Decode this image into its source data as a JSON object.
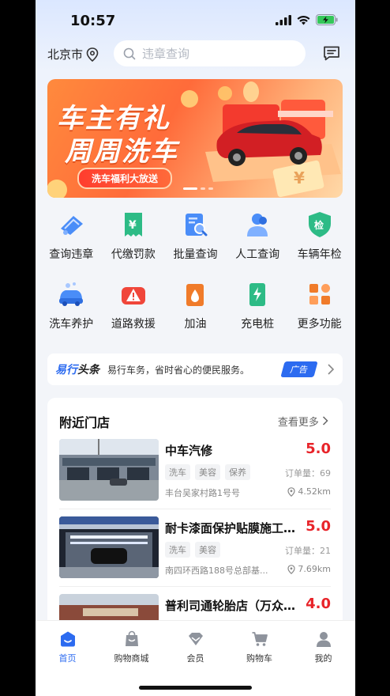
{
  "status": {
    "time": "10:57"
  },
  "header": {
    "city": "北京市",
    "search_placeholder": "违章查询"
  },
  "banner": {
    "line1": "车主有礼",
    "line2": "周周洗车",
    "pill": "洗车福利大放送"
  },
  "services": [
    {
      "label": "查询违章",
      "icon": "car-query-icon",
      "color": "#4a8df8"
    },
    {
      "label": "代缴罚款",
      "icon": "receipt-yuan-icon",
      "color": "#2dbb86"
    },
    {
      "label": "批量查询",
      "icon": "batch-search-icon",
      "color": "#4a8df8"
    },
    {
      "label": "人工查询",
      "icon": "agent-icon",
      "color": "#4a8df8"
    },
    {
      "label": "车辆年检",
      "icon": "shield-check-icon",
      "color": "#2dbb86"
    },
    {
      "label": "洗车养护",
      "icon": "car-wash-icon",
      "color": "#4a8df8"
    },
    {
      "label": "道路救援",
      "icon": "warning-triangle-icon",
      "color": "#f0463a"
    },
    {
      "label": "加油",
      "icon": "fuel-drop-icon",
      "color": "#f07b2a"
    },
    {
      "label": "充电桩",
      "icon": "charging-pile-icon",
      "color": "#2dbb86"
    },
    {
      "label": "更多功能",
      "icon": "more-grid-icon",
      "color": "#f07b2a"
    }
  ],
  "news": {
    "brand_a": "易行",
    "brand_b": "头条",
    "text": "易行车务，省时省心的便民服务。",
    "badge": "广告"
  },
  "stores_section": {
    "title": "附近门店",
    "more": "查看更多"
  },
  "stores": [
    {
      "name": "中车汽修",
      "price": "5.0",
      "tags": [
        "洗车",
        "美容",
        "保养"
      ],
      "orders": "订单量：69",
      "address": "丰台吴家村路1号号",
      "distance": "4.52km"
    },
    {
      "name": "耐卡漆面保护贴膜施工中心",
      "price": "5.0",
      "tags": [
        "洗车",
        "美容"
      ],
      "orders": "订单量：21",
      "address": "南四环西路188号总部基...",
      "distance": "7.69km"
    },
    {
      "name": "普利司通轮胎店（万众瑞...",
      "price": "4.0",
      "tags": [],
      "orders": "",
      "address": "",
      "distance": ""
    }
  ],
  "tabbar": [
    {
      "label": "首页",
      "icon": "home-icon",
      "active": true
    },
    {
      "label": "购物商城",
      "icon": "shopping-bag-icon",
      "active": false
    },
    {
      "label": "会员",
      "icon": "vip-diamond-icon",
      "active": false
    },
    {
      "label": "购物车",
      "icon": "cart-icon",
      "active": false
    },
    {
      "label": "我的",
      "icon": "user-icon",
      "active": false
    }
  ]
}
